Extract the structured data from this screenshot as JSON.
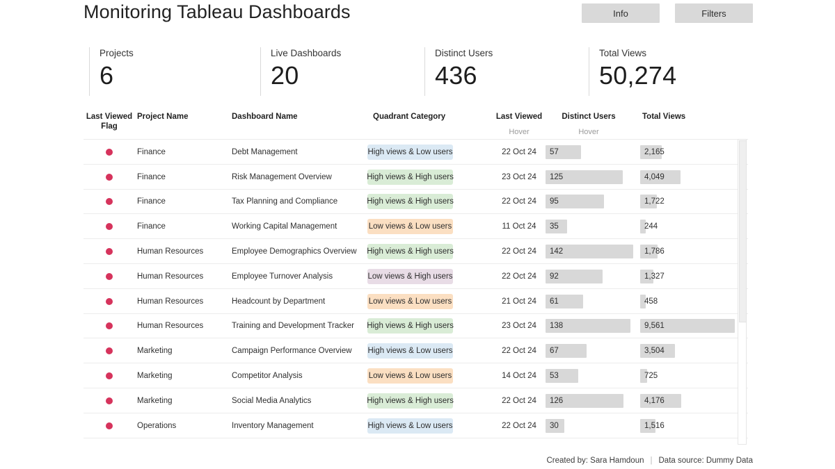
{
  "header": {
    "title": "Monitoring Tableau Dashboards",
    "buttons": [
      {
        "label": "Info",
        "name": "info-button"
      },
      {
        "label": "Filters",
        "name": "filters-button"
      }
    ]
  },
  "kpis": [
    {
      "label": "Projects",
      "value": "6"
    },
    {
      "label": "Live Dashboards",
      "value": "20"
    },
    {
      "label": "Distinct Users",
      "value": "436"
    },
    {
      "label": "Total Views",
      "value": "50,274"
    }
  ],
  "table": {
    "columns": {
      "flag": "Last Viewed\nFlag",
      "flag_line1": "Last Viewed",
      "flag_line2": "Flag",
      "project": "Project Name",
      "dashboard": "Dashboard Name",
      "quadrant": "Quadrant Category",
      "last_viewed": "Last Viewed",
      "last_viewed_sub": "Hover",
      "distinct_users": "Distinct Users",
      "distinct_users_sub": "Hover",
      "total_views": "Total Views"
    },
    "quadrant_colors": {
      "High views & Low users": "#dbe9f4",
      "High views & High users": "#d9ecd6",
      "Low views & High users": "#e8dce6",
      "Low views & Low users": "#fbdfc2"
    },
    "flag_color": "#d6335c",
    "bar_color": "#d8d8d8",
    "users_max": 142,
    "views_max": 9561,
    "rows": [
      {
        "flag": "flag-dot",
        "project": "Finance",
        "dashboard": "Debt Management",
        "quadrant": "High views & Low users",
        "quadrant_class": "q-hvlu",
        "last_viewed": "22 Oct 24",
        "distinct_users": 57,
        "distinct_users_text": "57",
        "total_views": 2165,
        "total_views_text": "2,165"
      },
      {
        "flag": "flag-dot",
        "project": "Finance",
        "dashboard": "Risk Management Overview",
        "quadrant": "High views & High users",
        "quadrant_class": "q-hvhu",
        "last_viewed": "23 Oct 24",
        "distinct_users": 125,
        "distinct_users_text": "125",
        "total_views": 4049,
        "total_views_text": "4,049"
      },
      {
        "flag": "flag-dot",
        "project": "Finance",
        "dashboard": "Tax Planning and Compliance",
        "quadrant": "High views & High users",
        "quadrant_class": "q-hvhu",
        "last_viewed": "22 Oct 24",
        "distinct_users": 95,
        "distinct_users_text": "95",
        "total_views": 1722,
        "total_views_text": "1,722"
      },
      {
        "flag": "flag-dot",
        "project": "Finance",
        "dashboard": "Working Capital Management",
        "quadrant": "Low views & Low users",
        "quadrant_class": "q-lvlu",
        "last_viewed": "11 Oct 24",
        "distinct_users": 35,
        "distinct_users_text": "35",
        "total_views": 244,
        "total_views_text": "244"
      },
      {
        "flag": "flag-dot",
        "project": "Human Resources",
        "dashboard": "Employee Demographics Overview",
        "quadrant": "High views & High users",
        "quadrant_class": "q-hvhu",
        "last_viewed": "22 Oct 24",
        "distinct_users": 142,
        "distinct_users_text": "142",
        "total_views": 1786,
        "total_views_text": "1,786"
      },
      {
        "flag": "flag-dot",
        "project": "Human Resources",
        "dashboard": "Employee Turnover Analysis",
        "quadrant": "Low views & High users",
        "quadrant_class": "q-lvhu",
        "last_viewed": "22 Oct 24",
        "distinct_users": 92,
        "distinct_users_text": "92",
        "total_views": 1327,
        "total_views_text": "1,327"
      },
      {
        "flag": "flag-dot",
        "project": "Human Resources",
        "dashboard": "Headcount by Department",
        "quadrant": "Low views & Low users",
        "quadrant_class": "q-lvlu",
        "last_viewed": "21 Oct 24",
        "distinct_users": 61,
        "distinct_users_text": "61",
        "total_views": 458,
        "total_views_text": "458"
      },
      {
        "flag": "flag-dot",
        "project": "Human Resources",
        "dashboard": "Training and Development Tracker",
        "quadrant": "High views & High users",
        "quadrant_class": "q-hvhu",
        "last_viewed": "23 Oct 24",
        "distinct_users": 138,
        "distinct_users_text": "138",
        "total_views": 9561,
        "total_views_text": "9,561"
      },
      {
        "flag": "flag-dot",
        "project": "Marketing",
        "dashboard": "Campaign Performance Overview",
        "quadrant": "High views & Low users",
        "quadrant_class": "q-hvlu",
        "last_viewed": "22 Oct 24",
        "distinct_users": 67,
        "distinct_users_text": "67",
        "total_views": 3504,
        "total_views_text": "3,504"
      },
      {
        "flag": "flag-dot",
        "project": "Marketing",
        "dashboard": "Competitor Analysis",
        "quadrant": "Low views & Low users",
        "quadrant_class": "q-lvlu",
        "last_viewed": "14 Oct 24",
        "distinct_users": 53,
        "distinct_users_text": "53",
        "total_views": 725,
        "total_views_text": "725"
      },
      {
        "flag": "flag-dot",
        "project": "Marketing",
        "dashboard": "Social Media Analytics",
        "quadrant": "High views & High users",
        "quadrant_class": "q-hvhu",
        "last_viewed": "22 Oct 24",
        "distinct_users": 126,
        "distinct_users_text": "126",
        "total_views": 4176,
        "total_views_text": "4,176"
      },
      {
        "flag": "flag-dot",
        "project": "Operations",
        "dashboard": "Inventory Management",
        "quadrant": "High views & Low users",
        "quadrant_class": "q-hvlu",
        "last_viewed": "22 Oct 24",
        "distinct_users": 30,
        "distinct_users_text": "30",
        "total_views": 1516,
        "total_views_text": "1,516"
      }
    ]
  },
  "footer": {
    "created_by": "Created by: Sara Hamdoun",
    "separator": "|",
    "data_source": "Data source: Dummy Data"
  }
}
